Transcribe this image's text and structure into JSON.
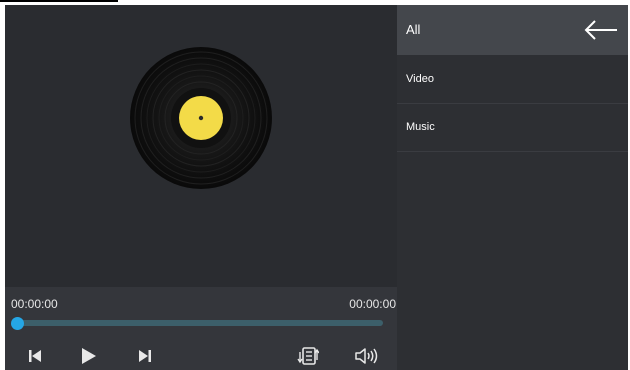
{
  "player": {
    "current_time": "00:00:00",
    "total_time": "00:00:00",
    "progress": 0
  },
  "controls": {
    "prev_icon": "skip-previous-icon",
    "play_icon": "play-icon",
    "next_icon": "skip-next-icon",
    "playlist_icon": "playlist-icon",
    "volume_icon": "volume-icon"
  },
  "sidebar": {
    "header": "All",
    "back_icon": "arrow-left-icon",
    "items": [
      {
        "label": "Video"
      },
      {
        "label": "Music"
      }
    ]
  },
  "colors": {
    "accent": "#25a7e6",
    "label_yellow": "#f3db48",
    "background": "#2b2d31"
  }
}
